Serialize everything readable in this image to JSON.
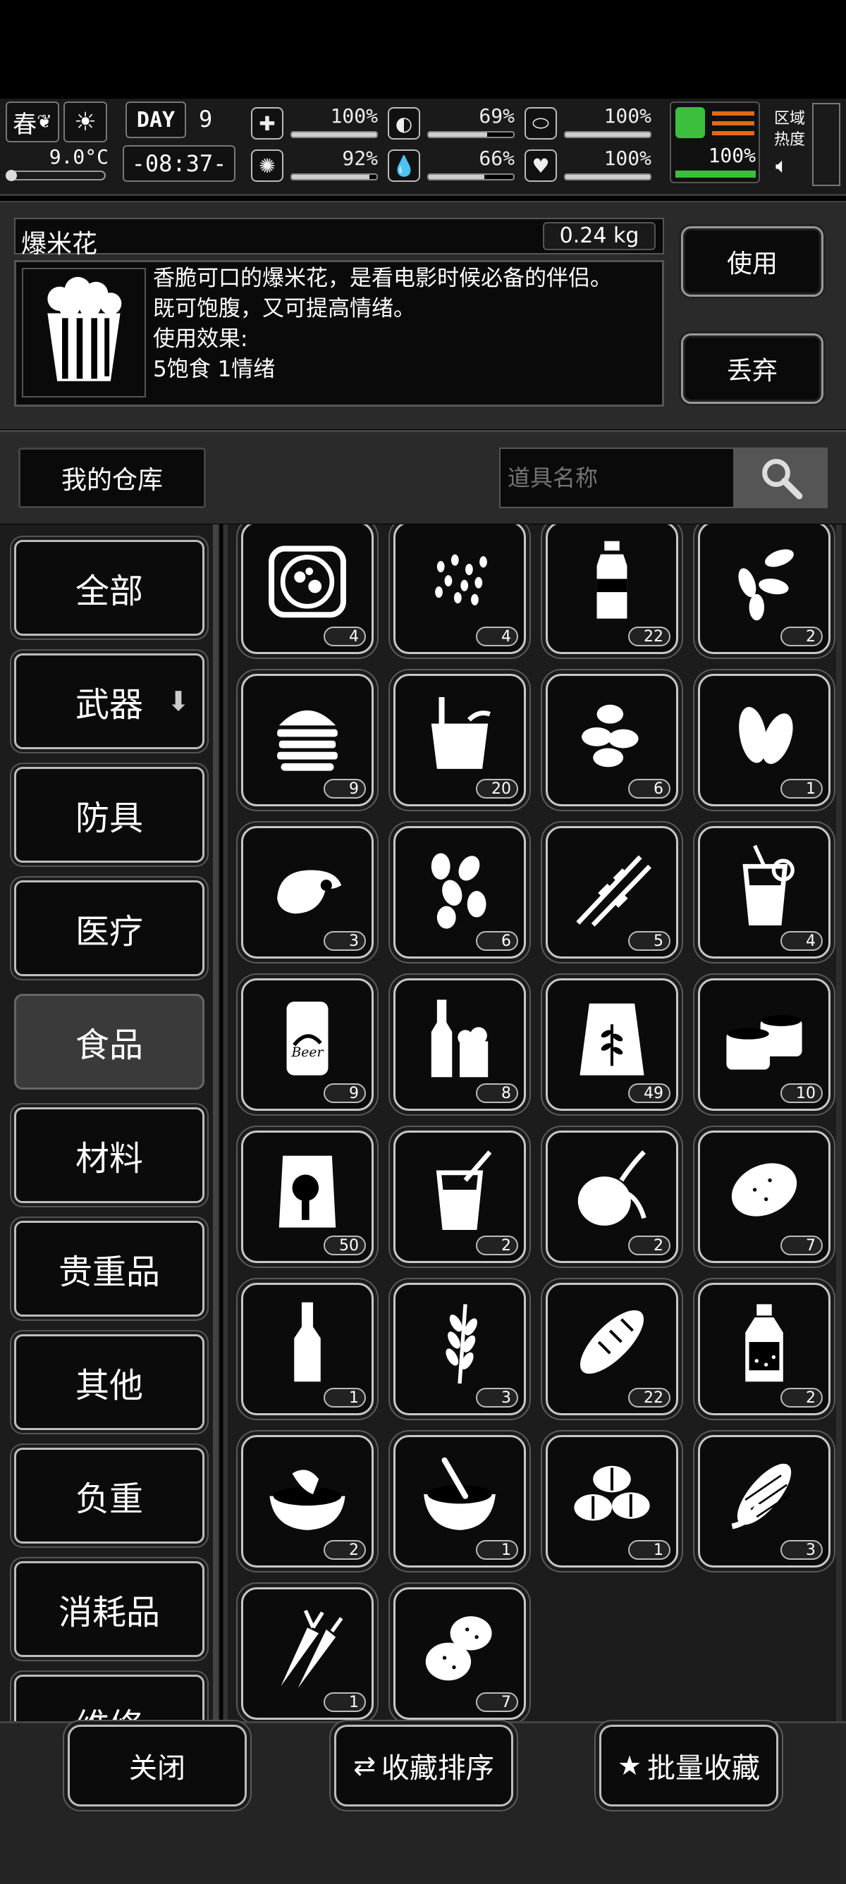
{
  "status": {
    "season": "春",
    "day_label": "DAY",
    "day_number": "9",
    "temperature": "9.0°C",
    "time": "-08:37-",
    "stats": [
      {
        "icon": "medkit-icon",
        "glyph": "✚",
        "value": "100%",
        "level": 1.0
      },
      {
        "icon": "stomach-icon",
        "glyph": "◐",
        "value": "69%",
        "level": 0.69
      },
      {
        "icon": "shield-icon",
        "glyph": "⬭",
        "value": "100%",
        "level": 1.0
      },
      {
        "icon": "brain-icon",
        "glyph": "✺",
        "value": "92%",
        "level": 0.92
      },
      {
        "icon": "water-drop-icon",
        "glyph": "💧",
        "value": "66%",
        "level": 0.66
      },
      {
        "icon": "heart-icon",
        "glyph": "♥",
        "value": "100%",
        "level": 1.0
      }
    ],
    "stamina": {
      "value": "100%",
      "level": 1.0
    },
    "zone_label": "区域热度",
    "sound_icon": "speaker-icon"
  },
  "selected_item": {
    "name": "爆米花",
    "weight": "0.24 kg",
    "icon": "popcorn-icon",
    "description": [
      "香脆可口的爆米花，是看电影时候必备的伴侣。",
      "既可饱腹，又可提高情绪。",
      "使用效果:",
      "5饱食 1情绪"
    ],
    "use_button": "使用",
    "discard_button": "丢弃"
  },
  "storage": {
    "title": "我的仓库",
    "search_placeholder": "道具名称",
    "search_icon": "search-icon"
  },
  "categories": [
    {
      "label": "全部",
      "active": false
    },
    {
      "label": "武器",
      "active": false,
      "extra_icon": "down-arrow-icon"
    },
    {
      "label": "防具",
      "active": false
    },
    {
      "label": "医疗",
      "active": false
    },
    {
      "label": "食品",
      "active": true
    },
    {
      "label": "材料",
      "active": false
    },
    {
      "label": "贵重品",
      "active": false
    },
    {
      "label": "其他",
      "active": false
    },
    {
      "label": "负重",
      "active": false
    },
    {
      "label": "消耗品",
      "active": false
    },
    {
      "label": "维修",
      "active": false
    }
  ],
  "items": [
    {
      "icon": "hotpot-icon",
      "qty": "4"
    },
    {
      "icon": "rice-grains-icon",
      "qty": "4"
    },
    {
      "icon": "water-bottle-icon",
      "qty": "22"
    },
    {
      "icon": "seeds-icon",
      "qty": "2"
    },
    {
      "icon": "burger-icon",
      "qty": "9"
    },
    {
      "icon": "instant-noodles-icon",
      "qty": "20"
    },
    {
      "icon": "almonds-icon",
      "qty": "6"
    },
    {
      "icon": "sunflower-seeds-icon",
      "qty": "1"
    },
    {
      "icon": "chicken-icon",
      "qty": "3"
    },
    {
      "icon": "peanuts-icon",
      "qty": "6"
    },
    {
      "icon": "skewers-icon",
      "qty": "5"
    },
    {
      "icon": "juice-icon",
      "qty": "4"
    },
    {
      "icon": "beer-can-icon",
      "qty": "9"
    },
    {
      "icon": "beer-bottle-icon",
      "qty": "8"
    },
    {
      "icon": "flour-bag-icon",
      "qty": "49"
    },
    {
      "icon": "canned-food-icon",
      "qty": "10"
    },
    {
      "icon": "meat-pack-icon",
      "qty": "50"
    },
    {
      "icon": "drink-cup-icon",
      "qty": "2"
    },
    {
      "icon": "onion-icon",
      "qty": "2"
    },
    {
      "icon": "potato-icon",
      "qty": "7"
    },
    {
      "icon": "liquor-bottle-icon",
      "qty": "1"
    },
    {
      "icon": "wheat-icon",
      "qty": "3"
    },
    {
      "icon": "bread-icon",
      "qty": "22"
    },
    {
      "icon": "sauce-bottle-icon",
      "qty": "2"
    },
    {
      "icon": "soup-bowl-icon",
      "qty": "2"
    },
    {
      "icon": "porridge-icon",
      "qty": "1"
    },
    {
      "icon": "beans-icon",
      "qty": "1"
    },
    {
      "icon": "corn-icon",
      "qty": "3"
    },
    {
      "icon": "carrot-icon",
      "qty": "1"
    },
    {
      "icon": "potatoes-icon",
      "qty": "7"
    }
  ],
  "bottom_buttons": {
    "close": "关闭",
    "sort": "收藏排序",
    "batch": "批量收藏"
  }
}
